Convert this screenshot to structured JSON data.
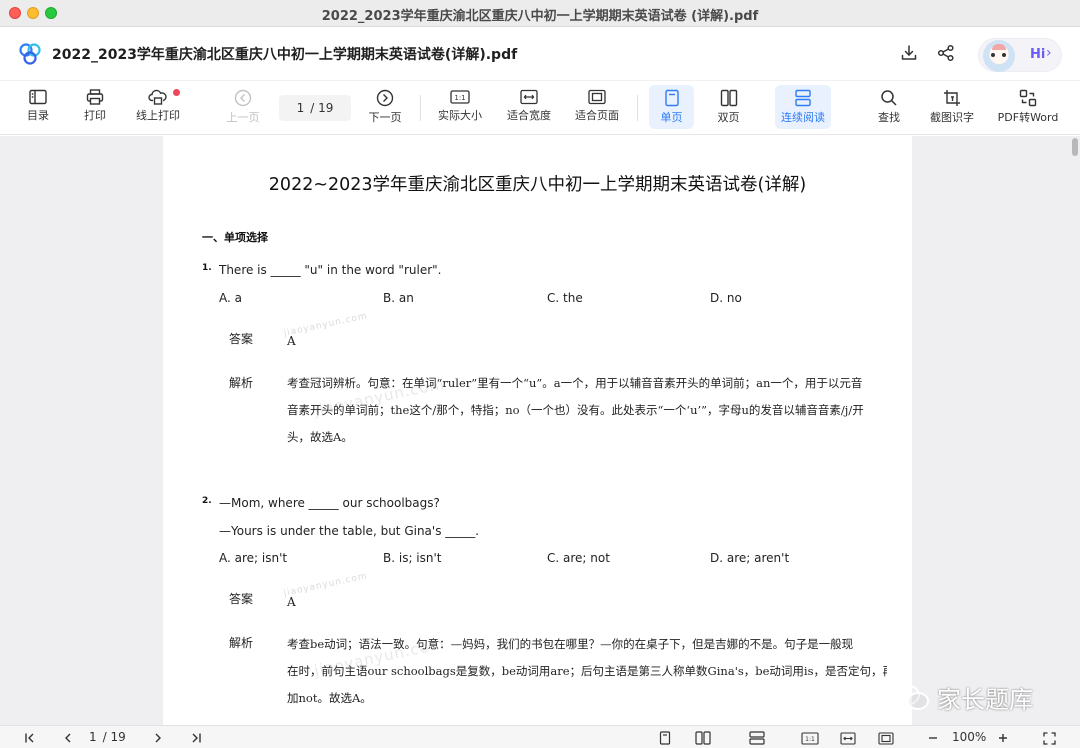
{
  "window": {
    "title": "2022_2023学年重庆渝北区重庆八中初一上学期期末英语试卷 (详解).pdf"
  },
  "header": {
    "doc_title": "2022_2023学年重庆渝北区重庆八中初一上学期期末英语试卷(详解).pdf",
    "download_icon": "download-icon",
    "share_icon": "share-icon",
    "assistant_label": "Hi"
  },
  "toolbar": {
    "items": [
      {
        "label": "目录",
        "icon": "outline-icon"
      },
      {
        "label": "打印",
        "icon": "printer-icon"
      },
      {
        "label": "线上打印",
        "icon": "cloud-print-icon"
      },
      {
        "label": "上一页",
        "icon": "prev-page-icon"
      },
      {
        "label": "下一页",
        "icon": "next-page-icon"
      },
      {
        "label": "实际大小",
        "icon": "actual-size-icon"
      },
      {
        "label": "适合宽度",
        "icon": "fit-width-icon"
      },
      {
        "label": "适合页面",
        "icon": "fit-page-icon"
      },
      {
        "label": "单页",
        "icon": "single-page-icon"
      },
      {
        "label": "双页",
        "icon": "double-page-icon"
      },
      {
        "label": "连续阅读",
        "icon": "continuous-icon"
      },
      {
        "label": "查找",
        "icon": "search-icon"
      },
      {
        "label": "截图识字",
        "icon": "screenshot-ocr-icon"
      },
      {
        "label": "PDF转Word",
        "icon": "pdf-to-word-icon"
      }
    ],
    "page_current": "1",
    "page_total": "/ 19",
    "actual_size_glyph": "1:1"
  },
  "document": {
    "heading": "2022~2023学年重庆渝北区重庆八中初一上学期期末英语试卷(详解)",
    "section": "一、单项选择",
    "answer_label": "答案",
    "explain_label": "解析",
    "watermark": "jiaoyanyun.com",
    "questions": [
      {
        "num": "1.",
        "lines": [
          "There is _____ \"u\" in the word \"ruler\"."
        ],
        "options": [
          "A. a",
          "B. an",
          "C. the",
          "D. no"
        ],
        "answer": "A",
        "explanation": [
          "考查冠词辨析。句意：在单词“ruler”里有一个“u”。a一个，用于以辅音音素开头的单词前；an一个，用于以元音",
          "音素开头的单词前；the这个/那个，特指；no（一个也）没有。此处表示“一个‘u’”，字母u的发音以辅音音素/j/开",
          "头，故选A。"
        ]
      },
      {
        "num": "2.",
        "lines": [
          "—Mom, where _____ our schoolbags?",
          "—Yours is under the table, but Gina's _____."
        ],
        "options": [
          "A. are; isn't",
          "B. is; isn't",
          "C. are; not",
          "D. are; aren't"
        ],
        "answer": "A",
        "explanation": [
          "考查be动词；语法一致。句意：—妈妈，我们的书包在哪里？—你的在桌子下，但是吉娜的不是。句子是一般现",
          "在时，前句主语our schoolbags是复数，be动词用are；后句主语是第三人称单数Gina's，be动词用is，是否定句，再",
          "加not。故选A。"
        ]
      }
    ]
  },
  "overlay": {
    "wechat_text": "家长题库",
    "wechat_icon": "wechat-icon"
  },
  "bottombar": {
    "page_current": "1",
    "page_total": "/ 19",
    "zoom": "100%",
    "actual_size_glyph": "1:1"
  }
}
